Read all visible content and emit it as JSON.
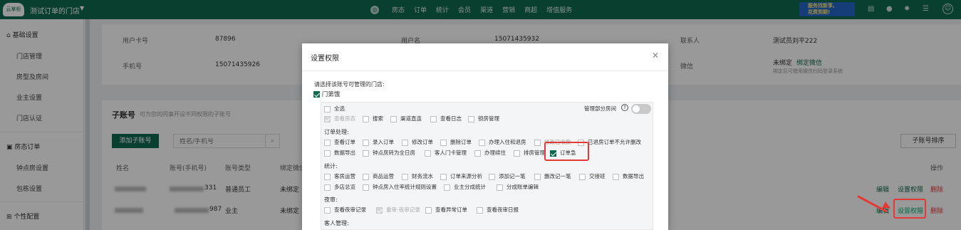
{
  "topbar": {
    "logo_text": "云掌柜",
    "store_name": "测试订单的门店",
    "nav": [
      "房态",
      "订单",
      "统计",
      "会员",
      "渠道",
      "营销",
      "商超",
      "增值服务"
    ],
    "banner_line1": "服务找新享,",
    "banner_line2": "花费到期!"
  },
  "sidebar": {
    "groups": [
      {
        "label": "基础设置",
        "items": [
          "门店管理",
          "房型及房间",
          "业主设置",
          "门店认证"
        ]
      },
      {
        "label": "房态订单",
        "items": [
          "钟点房设置",
          "包栋设置"
        ]
      },
      {
        "label": "个性配置",
        "items": []
      }
    ]
  },
  "account": {
    "card_no_label": "用户卡号",
    "card_no": "87896",
    "username_label": "用户名",
    "username": "15071435932",
    "contact_label": "联系人",
    "contact": "测试员刘平222",
    "phone_label": "手机号",
    "phone": "15071435926",
    "wechat_label": "微信",
    "wechat_status": "未绑定",
    "wechat_bind": "绑定微信",
    "wechat_hint": "绑定后可使用微信扫码登录系统"
  },
  "subaccounts": {
    "title": "子账号",
    "subtitle": "可为您的同事开设不同权限的子账号",
    "add_button": "添加子账号",
    "search_placeholder": "姓名/手机号",
    "sort_button": "子账号排序",
    "columns": [
      "姓名",
      "账号(手机号)",
      "账号类型",
      "绑定微信",
      "操作"
    ],
    "rows": [
      {
        "account_suffix": "331",
        "type": "普通员工",
        "wechat": "未绑定",
        "edit": "编辑",
        "perm": "设置权限",
        "del": "删除"
      },
      {
        "account_suffix": "987",
        "type": "业主",
        "wechat": "未绑定",
        "edit": "编辑",
        "perm": "设置权限",
        "del": "删除"
      }
    ]
  },
  "modal": {
    "title": "设置权限",
    "prompt": "请选择该账号可管理的门店:",
    "store": "门第饿",
    "partial_rooms_label": "管理部分房间",
    "help_icon": "?",
    "sections": {
      "general": [
        "全选",
        "查看房态",
        "搜索",
        "渠道直连",
        "查看日志",
        "锁房管理"
      ],
      "order_title": "订单处理:",
      "order": [
        "查看订单",
        "录入订单",
        "修改订单",
        "删除订单",
        "办理入住和退房",
        "修改已收款",
        "已退房订单不允许删改",
        "数据导出",
        "钟点房转为全日房",
        "客人门卡管理",
        "办理续住",
        "排房管理",
        "订单急"
      ],
      "stats_title": "统计:",
      "stats": [
        "客房运营",
        "商品运营",
        "财务流水",
        "订单来源分析",
        "添加记一笔",
        "删改记一笔",
        "交接班",
        "数据导出",
        "多店总览",
        "钟点房入住率统计规则设置",
        "业主分成统计",
        "分成账单编辑"
      ],
      "night_title": "夜审:",
      "night": [
        "查看夜审记录",
        "重审-夜审记录",
        "查看异常订单",
        "查看夜审日报"
      ],
      "guest_title": "客人管理:"
    }
  }
}
